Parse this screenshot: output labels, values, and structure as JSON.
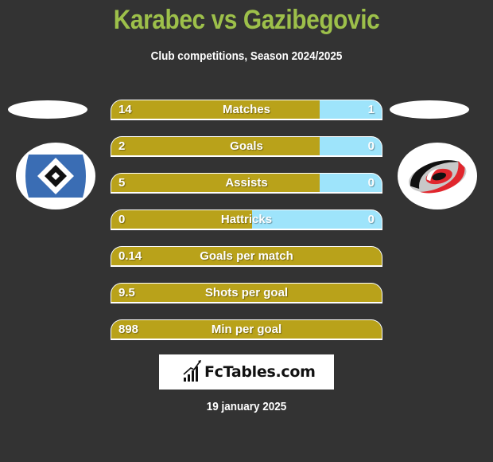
{
  "header": {
    "title": "Karabec vs Gazibegovic",
    "subtitle": "Club competitions, Season 2024/2025"
  },
  "teams": {
    "left": {
      "logo": "hamburger-sv-crest-icon"
    },
    "right": {
      "logo": "carolina-hurricanes-crest-icon"
    }
  },
  "colors": {
    "left_bar": "#b9a21a",
    "right_bar": "#9ee4fb",
    "title": "#9dc04a",
    "background": "#333333"
  },
  "stats": [
    {
      "label": "Matches",
      "left": "14",
      "right": "1",
      "left_share": 0.77
    },
    {
      "label": "Goals",
      "left": "2",
      "right": "0",
      "left_share": 0.77
    },
    {
      "label": "Assists",
      "left": "5",
      "right": "0",
      "left_share": 0.77
    },
    {
      "label": "Hattricks",
      "left": "0",
      "right": "0",
      "left_share": 0.52
    },
    {
      "label": "Goals per match",
      "left": "0.14",
      "right": "",
      "left_share": 1.0
    },
    {
      "label": "Shots per goal",
      "left": "9.5",
      "right": "",
      "left_share": 1.0
    },
    {
      "label": "Min per goal",
      "left": "898",
      "right": "",
      "left_share": 1.0
    }
  ],
  "brand": {
    "name": "FcTables.com",
    "icon": "bar-chart-trend-icon"
  },
  "footer": {
    "date": "19 january 2025"
  }
}
